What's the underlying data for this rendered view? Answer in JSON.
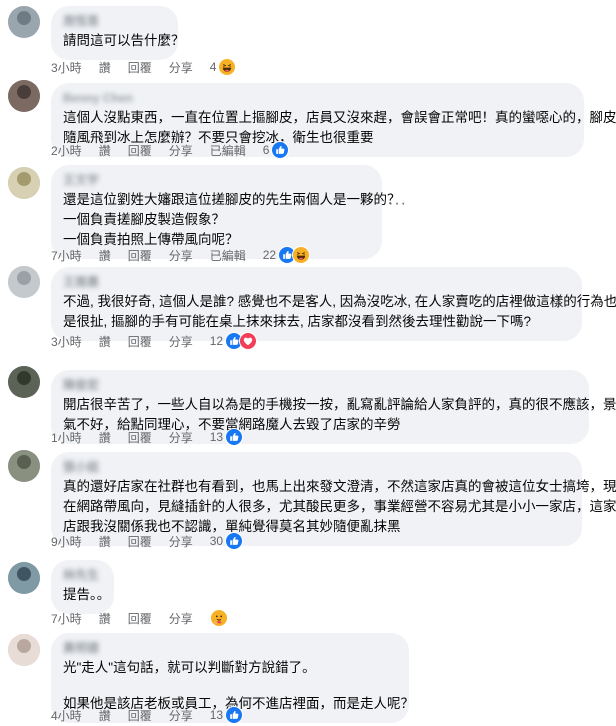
{
  "actions": {
    "like": "讚",
    "reply": "回覆",
    "share": "分享",
    "edited": "已編輯"
  },
  "comments": [
    {
      "author": "周恆恩",
      "lines": [
        "請問這可以告什麼？"
      ],
      "time": "3小時",
      "edited": false,
      "count": "4",
      "reactions": [
        "haha"
      ],
      "avatar": [
        "#9aa6ae",
        "#6e7b84"
      ]
    },
    {
      "author": "Benny Chen",
      "lines": [
        "這個人沒點東西，一直在位置上摳腳皮，店員又沒來趕，會誤會正常吧！真的蠻噁心的，腳皮",
        "隨風飛到冰上怎麼辦？不要只會挖冰，衛生也很重要"
      ],
      "time": "2小時",
      "edited": true,
      "count": "6",
      "reactions": [
        "like"
      ],
      "avatar": [
        "#7c6a62",
        "#4a3e3a"
      ]
    },
    {
      "author": "王文宇",
      "lines": [
        "還是這位劉姓大嬸跟這位搓腳皮的先生兩個人是一夥的？",
        "一個負責搓腳皮製造假象？",
        "一個負責拍照上傳帶風向呢？"
      ],
      "time": "7小時",
      "edited": true,
      "count": "22",
      "reactions": [
        "like",
        "haha"
      ],
      "avatar": [
        "#d7d0b2",
        "#a39b6e"
      ]
    },
    {
      "author": "王雅惠",
      "lines": [
        "不過, 我很好奇, 這個人是誰? 感覺也不是客人, 因為沒吃冰, 在人家賣吃的店裡做這樣的行為也",
        "是很扯, 摳腳的手有可能在桌上抹來抹去, 店家都沒看到然後去理性勸說一下嗎?"
      ],
      "time": "3小時",
      "edited": false,
      "count": "12",
      "reactions": [
        "like",
        "love"
      ],
      "avatar": [
        "#c4c9ce",
        "#9aa0a6"
      ]
    },
    {
      "author": "陳俊宏",
      "lines": [
        "開店很辛苦了，一些人自以為是的手機按一按，亂寫亂評論給人家負評的，真的很不應該，景",
        "氣不好，給點同理心，不要當網路魔人去毀了店家的辛勞"
      ],
      "time": "1小時",
      "edited": false,
      "count": "13",
      "reactions": [
        "like"
      ],
      "avatar": [
        "#5b6356",
        "#2f3a2c"
      ]
    },
    {
      "author": "張小姐",
      "lines": [
        "真的還好店家在社群也有看到，也馬上出來發文澄清，不然這家店真的會被這位女士搞垮，現",
        "在網路帶風向，見縫插針的人很多，尤其酸民更多，事業經營不容易尤其是小小一家店，這家",
        "店跟我沒關係我也不認識，單純覺得莫名其妙隨便亂抹黑"
      ],
      "time": "9小時",
      "edited": false,
      "count": "30",
      "reactions": [
        "like"
      ],
      "avatar": [
        "#8a9080",
        "#596052"
      ]
    },
    {
      "author": "林先生",
      "lines": [
        "提告。。"
      ],
      "time": "7小時",
      "edited": false,
      "count": "",
      "reactions": [
        "care"
      ],
      "avatar": [
        "#7f9aa4",
        "#3f5660"
      ]
    },
    {
      "author": "黃明德",
      "lines": [
        "光\"走人\"這句話，就可以判斷對方說錯了。",
        "",
        "如果他是該店老板或員工，為何不進店裡面，而是走人呢？"
      ],
      "time": "4小時",
      "edited": false,
      "count": "13",
      "reactions": [
        "like"
      ],
      "avatar": [
        "#e8dcd6",
        "#b9a8a0"
      ]
    }
  ],
  "more_button": "···",
  "icons": {
    "like": "thumbs-up-icon",
    "haha": "laughing-face-icon",
    "love": "heart-icon",
    "care": "care-face-icon",
    "more": "more-options-icon"
  },
  "colors": {
    "like": "#1877f2",
    "haha": "#f7b125",
    "love": "#f33e58",
    "bubble": "#f0f2f5",
    "meta": "#65676b"
  }
}
